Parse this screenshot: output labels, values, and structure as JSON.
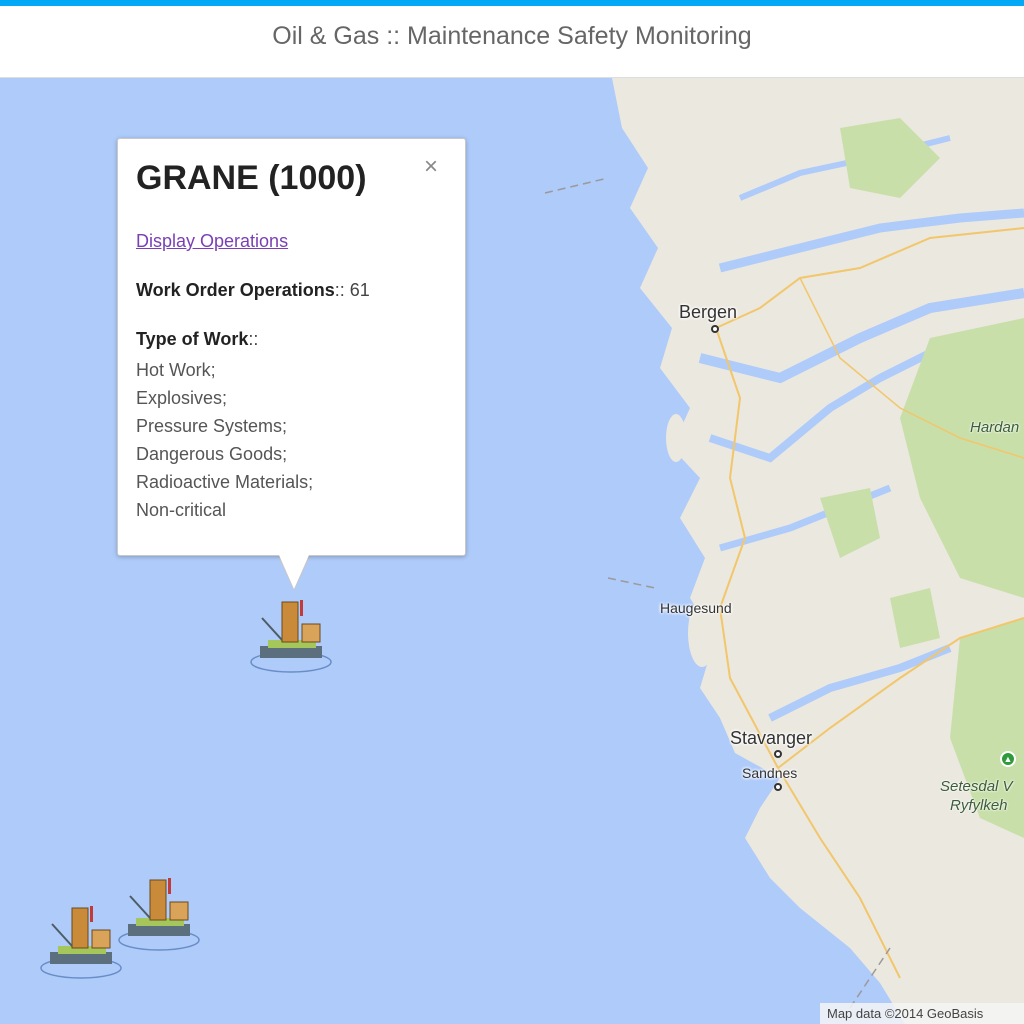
{
  "header": {
    "title": "Oil & Gas :: Maintenance Safety Monitoring",
    "accent_color": "#03a9f4"
  },
  "map": {
    "water_color": "#aecbfa",
    "land_color": "#ebe8df",
    "forest_color": "#c9dfaa",
    "places": {
      "bergen": "Bergen",
      "haugesund": "Haugesund",
      "stavanger": "Stavanger",
      "sandnes": "Sandnes",
      "hardanger": "Hardan",
      "setesdal": "Setesdal V",
      "ryfylke": "Ryfylkeh"
    },
    "attribution": "Map data ©2014 GeoBasis",
    "markers": [
      {
        "icon": "oil-rig-icon"
      },
      {
        "icon": "oil-rig-icon"
      },
      {
        "icon": "oil-rig-icon"
      }
    ]
  },
  "popup": {
    "title": "GRANE (1000)",
    "close_glyph": "×",
    "link_label": "Display Operations",
    "ops_label": "Work Order Operations",
    "ops_sep": ":: ",
    "ops_value": "61",
    "work_label": "Type of Work",
    "work_sep": "::",
    "work_types": [
      "Hot Work;",
      "Explosives;",
      "Pressure Systems;",
      "Dangerous Goods;",
      "Radioactive Materials;",
      "Non-critical"
    ]
  }
}
